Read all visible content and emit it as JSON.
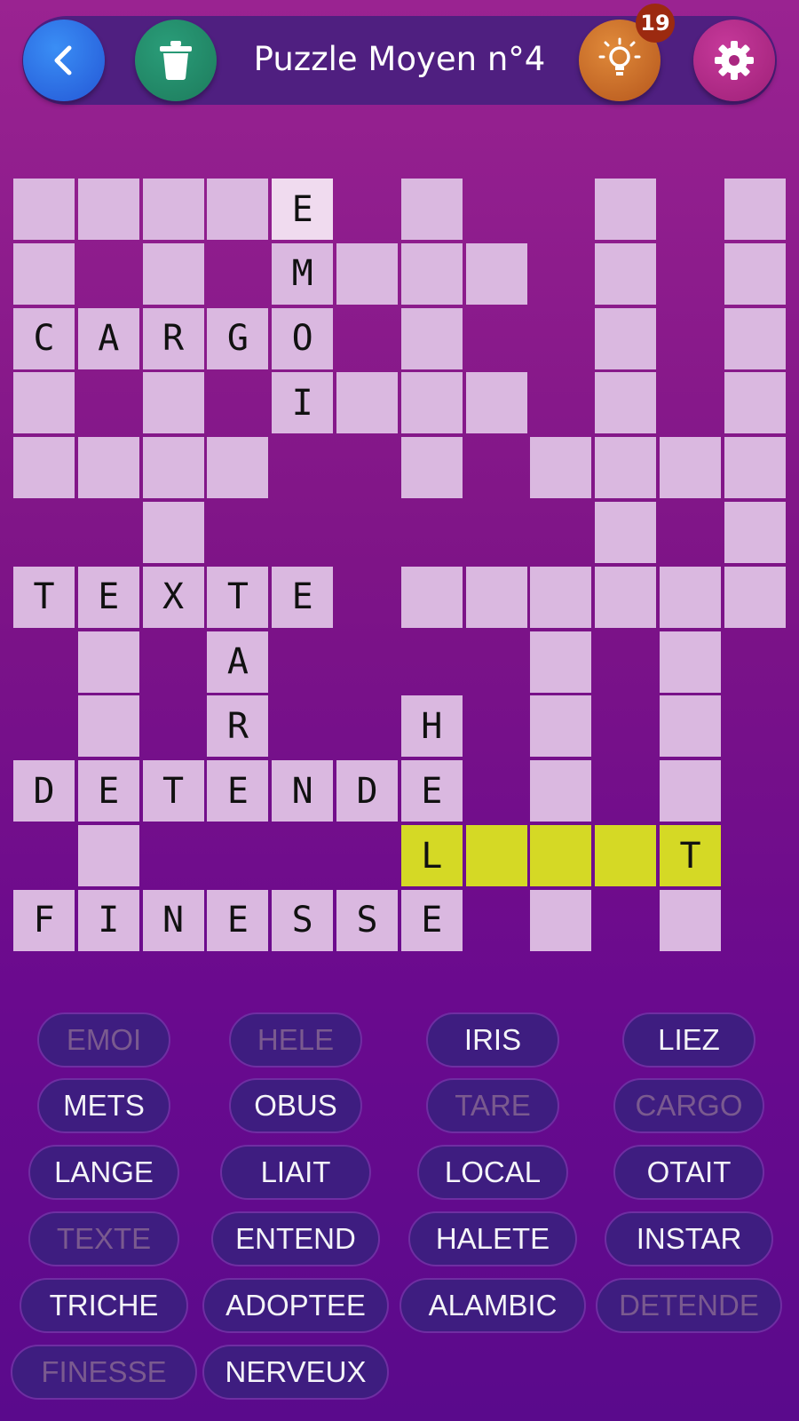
{
  "header": {
    "title": "Puzzle Moyen n°4",
    "hint_count": "19",
    "icons": [
      "back-arrow-icon",
      "trash-icon",
      "lightbulb-icon",
      "gear-icon"
    ]
  },
  "colors": {
    "cell": "#dab8e0",
    "selected_cell": "#f0dbef",
    "highlight": "#d5d925",
    "chip_bg": "#3e1d80",
    "chip_text_active": "#f4f4f8",
    "chip_text_used": "#7a5a8f"
  },
  "grid": {
    "cols": 12,
    "rows": 12,
    "cells": [
      {
        "r": 0,
        "c": 0,
        "l": ""
      },
      {
        "r": 0,
        "c": 1,
        "l": ""
      },
      {
        "r": 0,
        "c": 2,
        "l": ""
      },
      {
        "r": 0,
        "c": 3,
        "l": ""
      },
      {
        "r": 0,
        "c": 4,
        "l": "E",
        "s": "sel"
      },
      {
        "r": 0,
        "c": 6,
        "l": ""
      },
      {
        "r": 0,
        "c": 9,
        "l": ""
      },
      {
        "r": 0,
        "c": 11,
        "l": ""
      },
      {
        "r": 1,
        "c": 0,
        "l": ""
      },
      {
        "r": 1,
        "c": 2,
        "l": ""
      },
      {
        "r": 1,
        "c": 4,
        "l": "M"
      },
      {
        "r": 1,
        "c": 5,
        "l": ""
      },
      {
        "r": 1,
        "c": 6,
        "l": ""
      },
      {
        "r": 1,
        "c": 7,
        "l": ""
      },
      {
        "r": 1,
        "c": 9,
        "l": ""
      },
      {
        "r": 1,
        "c": 11,
        "l": ""
      },
      {
        "r": 2,
        "c": 0,
        "l": "C"
      },
      {
        "r": 2,
        "c": 1,
        "l": "A"
      },
      {
        "r": 2,
        "c": 2,
        "l": "R"
      },
      {
        "r": 2,
        "c": 3,
        "l": "G"
      },
      {
        "r": 2,
        "c": 4,
        "l": "O"
      },
      {
        "r": 2,
        "c": 6,
        "l": ""
      },
      {
        "r": 2,
        "c": 9,
        "l": ""
      },
      {
        "r": 2,
        "c": 11,
        "l": ""
      },
      {
        "r": 3,
        "c": 0,
        "l": ""
      },
      {
        "r": 3,
        "c": 2,
        "l": ""
      },
      {
        "r": 3,
        "c": 4,
        "l": "I"
      },
      {
        "r": 3,
        "c": 5,
        "l": ""
      },
      {
        "r": 3,
        "c": 6,
        "l": ""
      },
      {
        "r": 3,
        "c": 7,
        "l": ""
      },
      {
        "r": 3,
        "c": 9,
        "l": ""
      },
      {
        "r": 3,
        "c": 11,
        "l": ""
      },
      {
        "r": 4,
        "c": 0,
        "l": ""
      },
      {
        "r": 4,
        "c": 1,
        "l": ""
      },
      {
        "r": 4,
        "c": 2,
        "l": ""
      },
      {
        "r": 4,
        "c": 3,
        "l": ""
      },
      {
        "r": 4,
        "c": 6,
        "l": ""
      },
      {
        "r": 4,
        "c": 8,
        "l": ""
      },
      {
        "r": 4,
        "c": 9,
        "l": ""
      },
      {
        "r": 4,
        "c": 10,
        "l": ""
      },
      {
        "r": 4,
        "c": 11,
        "l": ""
      },
      {
        "r": 5,
        "c": 2,
        "l": ""
      },
      {
        "r": 5,
        "c": 9,
        "l": ""
      },
      {
        "r": 5,
        "c": 11,
        "l": ""
      },
      {
        "r": 6,
        "c": 0,
        "l": "T"
      },
      {
        "r": 6,
        "c": 1,
        "l": "E"
      },
      {
        "r": 6,
        "c": 2,
        "l": "X"
      },
      {
        "r": 6,
        "c": 3,
        "l": "T"
      },
      {
        "r": 6,
        "c": 4,
        "l": "E"
      },
      {
        "r": 6,
        "c": 6,
        "l": ""
      },
      {
        "r": 6,
        "c": 7,
        "l": ""
      },
      {
        "r": 6,
        "c": 8,
        "l": ""
      },
      {
        "r": 6,
        "c": 9,
        "l": ""
      },
      {
        "r": 6,
        "c": 10,
        "l": ""
      },
      {
        "r": 6,
        "c": 11,
        "l": ""
      },
      {
        "r": 7,
        "c": 1,
        "l": ""
      },
      {
        "r": 7,
        "c": 3,
        "l": "A"
      },
      {
        "r": 7,
        "c": 8,
        "l": ""
      },
      {
        "r": 7,
        "c": 10,
        "l": ""
      },
      {
        "r": 8,
        "c": 1,
        "l": ""
      },
      {
        "r": 8,
        "c": 3,
        "l": "R"
      },
      {
        "r": 8,
        "c": 6,
        "l": "H"
      },
      {
        "r": 8,
        "c": 8,
        "l": ""
      },
      {
        "r": 8,
        "c": 10,
        "l": ""
      },
      {
        "r": 9,
        "c": 0,
        "l": "D"
      },
      {
        "r": 9,
        "c": 1,
        "l": "E"
      },
      {
        "r": 9,
        "c": 2,
        "l": "T"
      },
      {
        "r": 9,
        "c": 3,
        "l": "E"
      },
      {
        "r": 9,
        "c": 4,
        "l": "N"
      },
      {
        "r": 9,
        "c": 5,
        "l": "D"
      },
      {
        "r": 9,
        "c": 6,
        "l": "E"
      },
      {
        "r": 9,
        "c": 8,
        "l": ""
      },
      {
        "r": 9,
        "c": 10,
        "l": ""
      },
      {
        "r": 10,
        "c": 1,
        "l": ""
      },
      {
        "r": 10,
        "c": 6,
        "l": "L",
        "s": "hl"
      },
      {
        "r": 10,
        "c": 7,
        "l": "",
        "s": "hl"
      },
      {
        "r": 10,
        "c": 8,
        "l": "",
        "s": "hl"
      },
      {
        "r": 10,
        "c": 9,
        "l": "",
        "s": "hl"
      },
      {
        "r": 10,
        "c": 10,
        "l": "T",
        "s": "hl"
      },
      {
        "r": 11,
        "c": 0,
        "l": "F"
      },
      {
        "r": 11,
        "c": 1,
        "l": "I"
      },
      {
        "r": 11,
        "c": 2,
        "l": "N"
      },
      {
        "r": 11,
        "c": 3,
        "l": "E"
      },
      {
        "r": 11,
        "c": 4,
        "l": "S"
      },
      {
        "r": 11,
        "c": 5,
        "l": "S"
      },
      {
        "r": 11,
        "c": 6,
        "l": "E"
      },
      {
        "r": 11,
        "c": 8,
        "l": ""
      },
      {
        "r": 11,
        "c": 10,
        "l": ""
      }
    ]
  },
  "word_bank": [
    {
      "word": "EMOI",
      "used": true
    },
    {
      "word": "HELE",
      "used": true
    },
    {
      "word": "IRIS",
      "used": false
    },
    {
      "word": "LIEZ",
      "used": false
    },
    {
      "word": "METS",
      "used": false
    },
    {
      "word": "OBUS",
      "used": false
    },
    {
      "word": "TARE",
      "used": true
    },
    {
      "word": "CARGO",
      "used": true
    },
    {
      "word": "LANGE",
      "used": false
    },
    {
      "word": "LIAIT",
      "used": false
    },
    {
      "word": "LOCAL",
      "used": false
    },
    {
      "word": "OTAIT",
      "used": false
    },
    {
      "word": "TEXTE",
      "used": true
    },
    {
      "word": "ENTEND",
      "used": false
    },
    {
      "word": "HALETE",
      "used": false
    },
    {
      "word": "INSTAR",
      "used": false
    },
    {
      "word": "TRICHE",
      "used": false
    },
    {
      "word": "ADOPTEE",
      "used": false
    },
    {
      "word": "ALAMBIC",
      "used": false
    },
    {
      "word": "DETENDE",
      "used": true
    },
    {
      "word": "FINESSE",
      "used": true
    },
    {
      "word": "NERVEUX",
      "used": false
    }
  ]
}
